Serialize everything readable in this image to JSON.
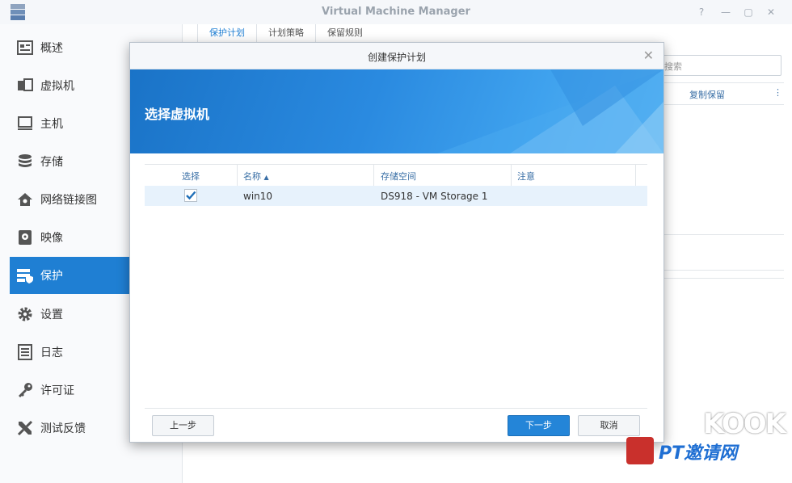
{
  "window": {
    "title": "Virtual Machine Manager",
    "controls": [
      "help-icon",
      "minimize-icon",
      "maximize-icon",
      "close-icon"
    ]
  },
  "sidebar": {
    "items": [
      {
        "label": "概述",
        "icon": "overview-icon"
      },
      {
        "label": "虚拟机",
        "icon": "vm-icon"
      },
      {
        "label": "主机",
        "icon": "host-icon"
      },
      {
        "label": "存储",
        "icon": "storage-icon"
      },
      {
        "label": "网络链接图",
        "icon": "network-icon"
      },
      {
        "label": "映像",
        "icon": "image-icon"
      },
      {
        "label": "保护",
        "icon": "protection-icon",
        "active": true
      },
      {
        "label": "设置",
        "icon": "gear-icon"
      },
      {
        "label": "日志",
        "icon": "log-icon"
      },
      {
        "label": "许可证",
        "icon": "key-icon"
      },
      {
        "label": "测试反馈",
        "icon": "wrench-icon"
      }
    ]
  },
  "background": {
    "tabs": [
      "保护计划",
      "计划策略",
      "保留规则"
    ],
    "search_placeholder": "搜索",
    "column_header": "复制保留"
  },
  "modal": {
    "title": "创建保护计划",
    "banner_title": "选择虚拟机",
    "columns": {
      "select": "选择",
      "name": "名称",
      "storage": "存储空间",
      "note": "注意"
    },
    "rows": [
      {
        "selected": true,
        "name": "win10",
        "storage": "DS918 - VM Storage 1",
        "note": ""
      }
    ],
    "buttons": {
      "prev": "上一步",
      "next": "下一步",
      "cancel": "取消"
    }
  },
  "watermark": {
    "line1": "KOOK",
    "line2": "PT邀请网"
  },
  "colors": {
    "accent": "#1f7fd3",
    "banner": "#2a8ae0"
  }
}
